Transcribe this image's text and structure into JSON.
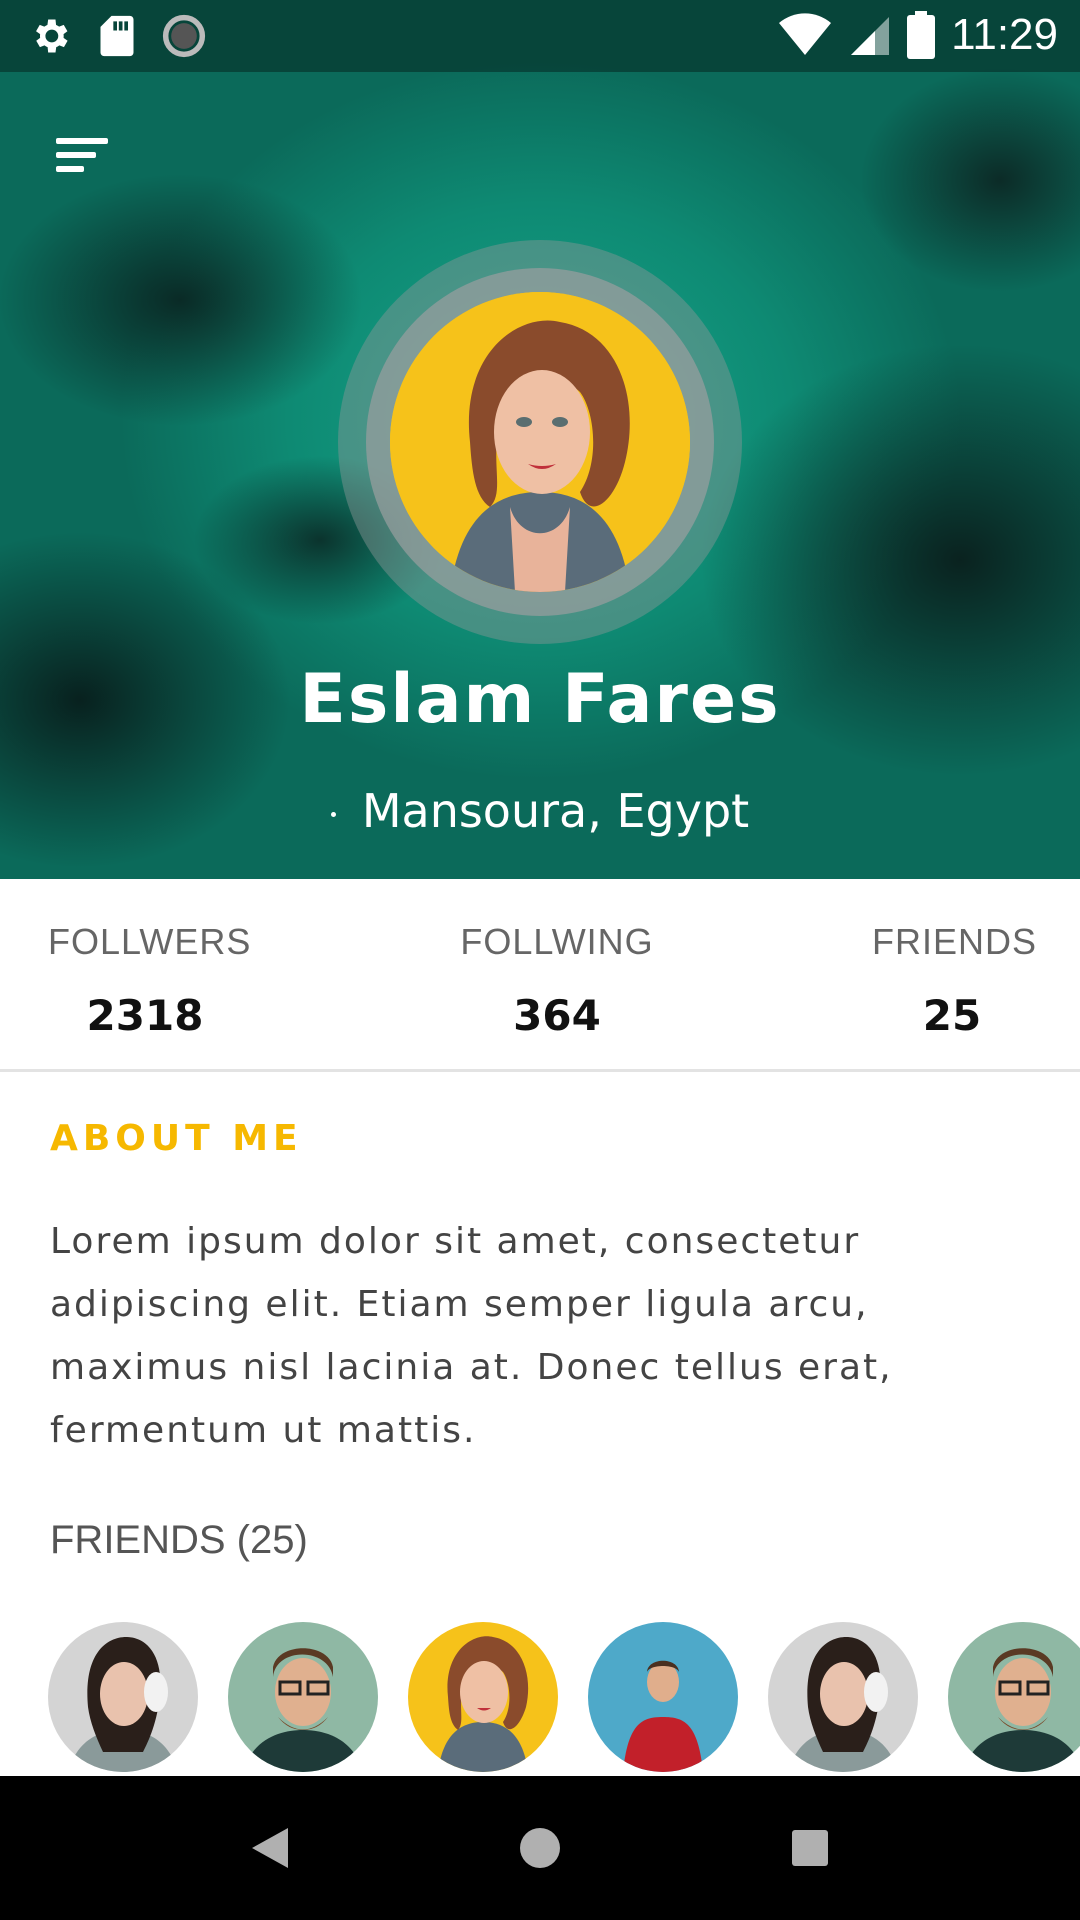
{
  "status_bar": {
    "time": "11:29",
    "icons": [
      "gear-icon",
      "sd-card-icon",
      "loading-icon",
      "wifi-icon",
      "signal-icon",
      "battery-icon"
    ]
  },
  "header": {
    "menu_icon": "sort-menu-icon",
    "name": "Eslam Fares",
    "location": "Mansoura, Egypt"
  },
  "stats": [
    {
      "label": "FOLLWERS",
      "value": "2318"
    },
    {
      "label": "FOLLWING",
      "value": "364"
    },
    {
      "label": "FRIENDS",
      "value": "25"
    }
  ],
  "about": {
    "title": "ABOUT ME",
    "text": "Lorem ipsum dolor sit amet, consectetur adipiscing elit. Etiam semper ligula arcu, maximus nisl lacinia at. Donec tellus erat, fermentum ut mattis."
  },
  "friends": {
    "title": "FRIENDS (25)"
  },
  "nav": {
    "back_icon": "back-triangle-icon",
    "home_icon": "home-circle-icon",
    "recents_icon": "recents-square-icon"
  },
  "colors": {
    "accent": "#F6B800",
    "hero_teal": "#17A58A",
    "avatar_yellow": "#F6C21A"
  }
}
